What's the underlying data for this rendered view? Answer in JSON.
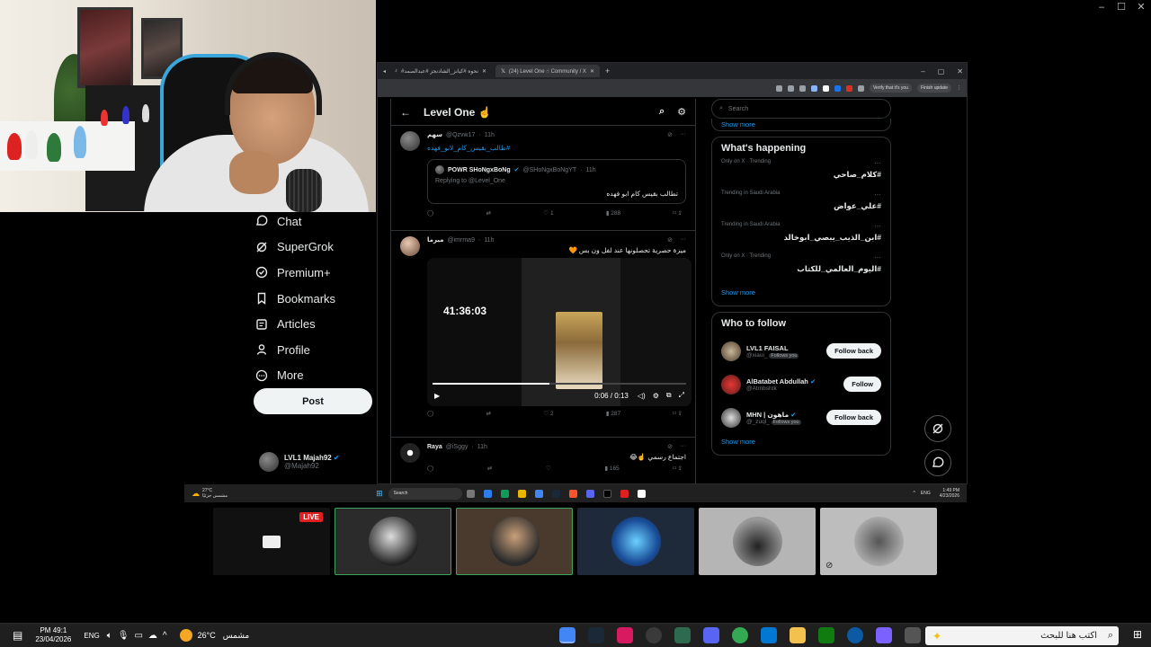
{
  "browser": {
    "tabs": [
      {
        "label": "#نحوه #كيانز_الشادنجز #عبدالصمد"
      },
      {
        "label": "(24) Level One ☝ Community / X"
      }
    ],
    "toolbar_pills": [
      "Verify that it's you",
      "Finish update"
    ]
  },
  "x_nav": {
    "items": [
      {
        "label": "Chat",
        "icon": "chat-icon"
      },
      {
        "label": "SuperGrok",
        "icon": "grok-icon"
      },
      {
        "label": "Premium+",
        "icon": "verified-icon"
      },
      {
        "label": "Bookmarks",
        "icon": "bookmark-icon"
      },
      {
        "label": "Articles",
        "icon": "article-icon"
      },
      {
        "label": "Profile",
        "icon": "profile-icon"
      },
      {
        "label": "More",
        "icon": "more-icon"
      }
    ],
    "post_label": "Post",
    "account": {
      "name": "LVL1 Majah92",
      "handle": "@Majah92"
    }
  },
  "column": {
    "title": "Level One ☝️"
  },
  "tweets": [
    {
      "name": "سهم",
      "handle": "@Qzvw17",
      "time": "11h",
      "text": "#طالب_بقيس_كام_لانو_فهده",
      "quote": {
        "name": "POWR SHoNgxBoNg",
        "handle": "@SHoNgxBoNgYT",
        "time": "11h",
        "replying": "Replying to @Level_One",
        "text": "تطالب بقيس كام ابو فهده"
      },
      "actions": {
        "reply": "",
        "repost": "",
        "like": "1",
        "views": "288"
      }
    },
    {
      "name": "ميرما",
      "handle": "@imrma9",
      "time": "11h",
      "text": "ميزة حصرية تحصلونها عند لفل ون بس 🧡",
      "video": {
        "timer": "41:36:03",
        "time": "0:06 / 0:13",
        "progress": 0.46
      },
      "actions": {
        "reply": "",
        "repost": "",
        "like": "2",
        "views": "287"
      }
    },
    {
      "name": "Raya",
      "handle": "@iSggy",
      "time": "11h",
      "text": "اجتماع رسمي ☝️😂",
      "actions": {
        "reply": "",
        "repost": "",
        "like": "",
        "views": "165"
      }
    }
  ],
  "search": {
    "placeholder": "Search"
  },
  "sidebar_top_showmore": "Show more",
  "happening": {
    "title": "What's happening",
    "trends": [
      {
        "context": "Only on X · Trending",
        "name": "#كلام_صاحي"
      },
      {
        "context": "Trending in Saudi Arabia",
        "name": "#علي_عواض"
      },
      {
        "context": "Trending in Saudi Arabia",
        "name": "#ابن_الذيب_يبصي_ابوخالد"
      },
      {
        "context": "Only on X · Trending",
        "name": "#اليوم_العالمي_للكتاب"
      }
    ],
    "show_more": "Show more"
  },
  "who_to_follow": {
    "title": "Who to follow",
    "people": [
      {
        "name": "LVL1 FAISAL",
        "handle": "@xiaui_",
        "badge": "Follows you",
        "button": "Follow back"
      },
      {
        "name": "AlBatabet Abdullah",
        "handle": "@Atmbshtk",
        "badge": "",
        "button": "Follow"
      },
      {
        "name": "MHN | ماهون",
        "handle": "@_zuql_",
        "badge": "Follows you",
        "button": "Follow back"
      }
    ],
    "show_more": "Show more"
  },
  "inner_taskbar": {
    "weather_temp": "27°C",
    "weather_text": "مشمس جزئيًا",
    "search": "Search",
    "lang": "ENG",
    "time": "1:49 PM",
    "date": "4/23/2026"
  },
  "live_badge": "LIVE",
  "taskbar": {
    "time": "PM 49:1",
    "date": "23/04/2026",
    "lang": "ENG",
    "temp": "26°C",
    "weather": "مشمس",
    "search_placeholder": "اكتب هنا للبحث"
  },
  "colors": {
    "accent": "#1d9bf0",
    "bg": "#000000",
    "live": "#e02020"
  }
}
